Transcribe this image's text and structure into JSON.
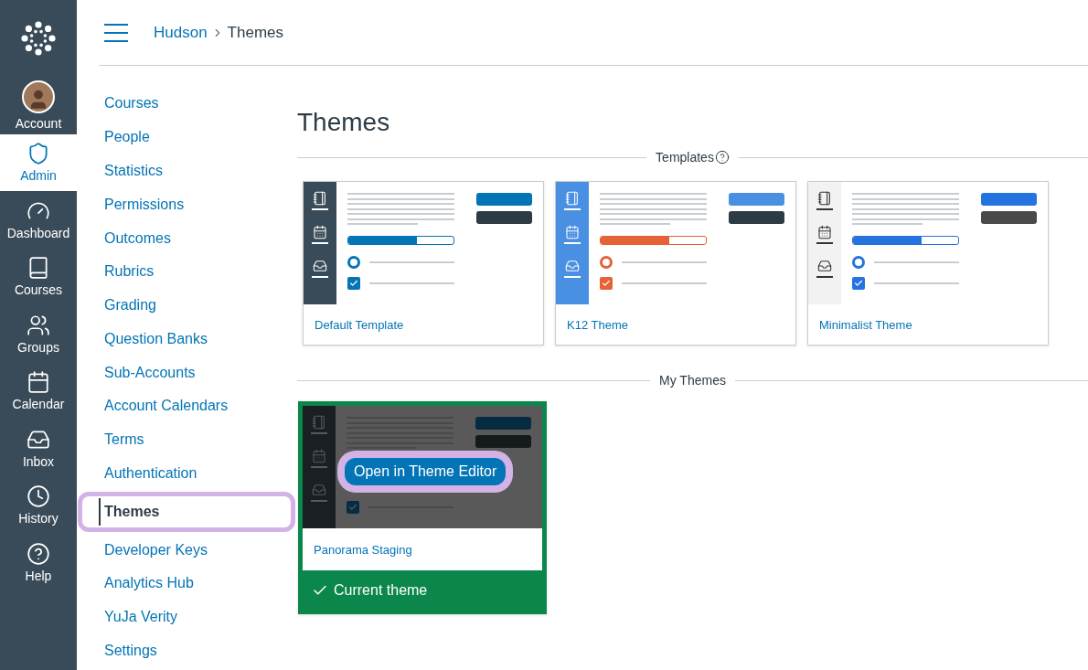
{
  "global_nav": {
    "items": [
      {
        "label": "Account",
        "kind": "avatar",
        "selected": false
      },
      {
        "label": "Admin",
        "kind": "admin",
        "selected": true
      },
      {
        "label": "Dashboard",
        "kind": "dashboard",
        "selected": false
      },
      {
        "label": "Courses",
        "kind": "courses",
        "selected": false
      },
      {
        "label": "Groups",
        "kind": "groups",
        "selected": false
      },
      {
        "label": "Calendar",
        "kind": "calendar",
        "selected": false
      },
      {
        "label": "Inbox",
        "kind": "inbox",
        "selected": false
      },
      {
        "label": "History",
        "kind": "history",
        "selected": false
      },
      {
        "label": "Help",
        "kind": "help",
        "selected": false
      }
    ]
  },
  "header": {
    "breadcrumb": [
      "Hudson",
      "Themes"
    ]
  },
  "sub_nav": {
    "items": [
      {
        "label": "Courses",
        "selected": false,
        "highlighted": false
      },
      {
        "label": "People",
        "selected": false,
        "highlighted": false
      },
      {
        "label": "Statistics",
        "selected": false,
        "highlighted": false
      },
      {
        "label": "Permissions",
        "selected": false,
        "highlighted": false
      },
      {
        "label": "Outcomes",
        "selected": false,
        "highlighted": false
      },
      {
        "label": "Rubrics",
        "selected": false,
        "highlighted": false
      },
      {
        "label": "Grading",
        "selected": false,
        "highlighted": false
      },
      {
        "label": "Question Banks",
        "selected": false,
        "highlighted": false
      },
      {
        "label": "Sub-Accounts",
        "selected": false,
        "highlighted": false
      },
      {
        "label": "Account Calendars",
        "selected": false,
        "highlighted": false
      },
      {
        "label": "Terms",
        "selected": false,
        "highlighted": false
      },
      {
        "label": "Authentication",
        "selected": false,
        "highlighted": false
      },
      {
        "label": "Themes",
        "selected": true,
        "highlighted": true
      },
      {
        "label": "Developer Keys",
        "selected": false,
        "highlighted": false
      },
      {
        "label": "Analytics Hub",
        "selected": false,
        "highlighted": false
      },
      {
        "label": "YuJa Verity",
        "selected": false,
        "highlighted": false
      },
      {
        "label": "Settings",
        "selected": false,
        "highlighted": false
      }
    ]
  },
  "page_title": "Themes",
  "templates": {
    "heading": "Templates",
    "themes": [
      {
        "name": "Default Template",
        "kind": "default",
        "level": 0.65,
        "dimmed": false,
        "current": false
      },
      {
        "name": "K12 Theme",
        "kind": "k12",
        "level": 0.65,
        "dimmed": false,
        "current": false
      },
      {
        "name": "Minimalist Theme",
        "kind": "minimalist",
        "level": 0.65,
        "dimmed": false,
        "current": false
      }
    ]
  },
  "my_themes": {
    "heading": "My Themes",
    "themes": [
      {
        "name": "Panorama Staging",
        "kind": "default",
        "level": 0.65,
        "dimmed": true,
        "current": true,
        "current_label": "Current theme",
        "action": {
          "label": "Open in Theme Editor",
          "highlighted": true
        }
      }
    ]
  }
}
